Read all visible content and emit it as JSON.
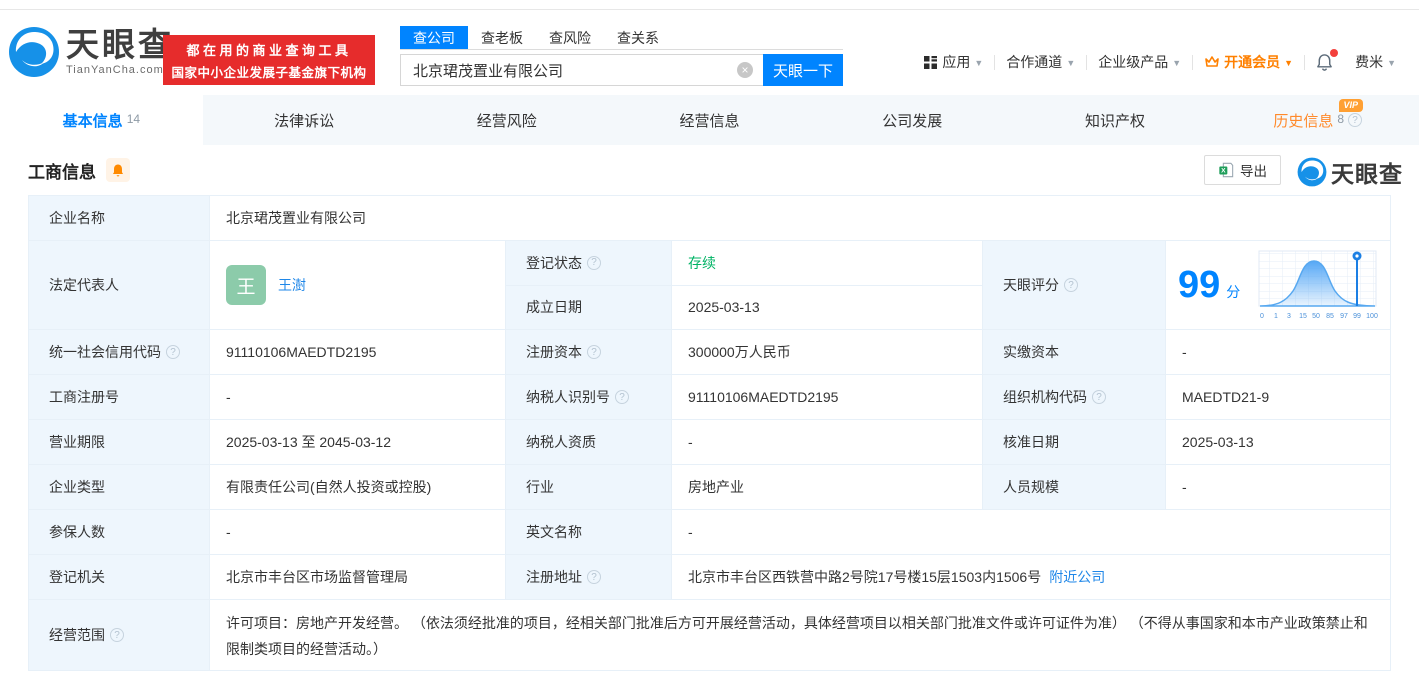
{
  "brand": {
    "name": "天眼查",
    "domain": "TianYanCha.com",
    "slogan_line1": "都在用的商业查询工具",
    "slogan_line2": "国家中小企业发展子基金旗下机构"
  },
  "search": {
    "tabs": [
      {
        "label": "查公司",
        "active": true
      },
      {
        "label": "查老板",
        "active": false
      },
      {
        "label": "查风险",
        "active": false
      },
      {
        "label": "查关系",
        "active": false
      }
    ],
    "value": "北京珺茂置业有限公司",
    "button": "天眼一下"
  },
  "nav": {
    "apps": "应用",
    "partner": "合作通道",
    "enterprise": "企业级产品",
    "vip": "开通会员",
    "user": "费米"
  },
  "tabs": [
    {
      "label": "基本信息",
      "count": "14",
      "active": true
    },
    {
      "label": "法律诉讼"
    },
    {
      "label": "经营风险"
    },
    {
      "label": "经营信息"
    },
    {
      "label": "公司发展"
    },
    {
      "label": "知识产权"
    },
    {
      "label": "历史信息",
      "count": "8",
      "vip_badge": "VIP"
    }
  ],
  "section": {
    "title": "工商信息",
    "export_label": "导出",
    "watermark": "天眼查"
  },
  "fields": {
    "company_name": {
      "label": "企业名称",
      "value": "北京珺茂置业有限公司"
    },
    "legal_rep": {
      "label": "法定代表人",
      "avatar": "王",
      "name": "王澍"
    },
    "reg_status": {
      "label": "登记状态",
      "value": "存续"
    },
    "establish_date": {
      "label": "成立日期",
      "value": "2025-03-13"
    },
    "score": {
      "label": "天眼评分",
      "value": "99",
      "unit": "分"
    },
    "credit_code": {
      "label": "统一社会信用代码",
      "value": "91110106MAEDTD2195"
    },
    "reg_capital": {
      "label": "注册资本",
      "value": "300000万人民币"
    },
    "paid_capital": {
      "label": "实缴资本",
      "value": "-"
    },
    "reg_number": {
      "label": "工商注册号",
      "value": "-"
    },
    "taxpayer_id": {
      "label": "纳税人识别号",
      "value": "91110106MAEDTD2195"
    },
    "org_code": {
      "label": "组织机构代码",
      "value": "MAEDTD21-9"
    },
    "business_term": {
      "label": "营业期限",
      "value": "2025-03-13 至 2045-03-12"
    },
    "taxpayer_quality": {
      "label": "纳税人资质",
      "value": "-"
    },
    "approval_date": {
      "label": "核准日期",
      "value": "2025-03-13"
    },
    "company_type": {
      "label": "企业类型",
      "value": "有限责任公司(自然人投资或控股)"
    },
    "industry": {
      "label": "行业",
      "value": "房地产业"
    },
    "staff_size": {
      "label": "人员规模",
      "value": "-"
    },
    "insured_count": {
      "label": "参保人数",
      "value": "-"
    },
    "english_name": {
      "label": "英文名称",
      "value": "-"
    },
    "reg_authority": {
      "label": "登记机关",
      "value": "北京市丰台区市场监督管理局"
    },
    "reg_address": {
      "label": "注册地址",
      "value": "北京市丰台区西铁营中路2号院17号楼15层1503内1506号",
      "link": "附近公司"
    },
    "business_scope": {
      "label": "经营范围",
      "value": "许可项目：房地产开发经营。 （依法须经批准的项目，经相关部门批准后方可开展经营活动，具体经营项目以相关部门批准文件或许可证件为准） （不得从事国家和本市产业政策禁止和限制类项目的经营活动。）"
    }
  },
  "score_chart": {
    "type": "area",
    "x_labels": [
      "0",
      "1",
      "3",
      "15",
      "50",
      "85",
      "97",
      "99",
      "100"
    ],
    "marker_at": "99",
    "description": "bell-curve score distribution with marker pin at 99"
  },
  "colors": {
    "brand_blue": "#0084ff",
    "banner_red": "#e62c2c",
    "link_blue": "#1f87e8",
    "status_green": "#00b365",
    "vip_orange": "#ff8a2b",
    "avatar_green": "#8ccbaa",
    "label_cell_bg": "#eef6fd"
  }
}
